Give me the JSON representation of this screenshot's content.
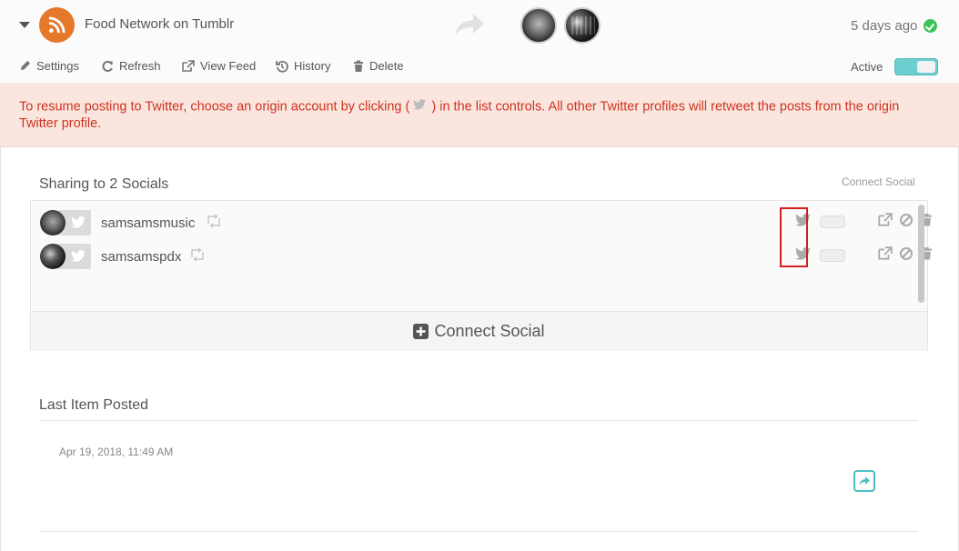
{
  "header": {
    "feed_title": "Food Network on Tumblr",
    "time_ago": "5 days ago",
    "active_label": "Active",
    "accent_color": "#6ccfcf"
  },
  "toolbar": {
    "settings": "Settings",
    "refresh": "Refresh",
    "view_feed": "View Feed",
    "history": "History",
    "delete": "Delete"
  },
  "warning": {
    "text_before": "To resume posting to Twitter, choose an origin account by clicking (",
    "text_after": ") in the list controls. All other Twitter profiles will retweet the posts from the origin Twitter profile.",
    "color": "#d0321e"
  },
  "sharing": {
    "title": "Sharing to 2 Socials",
    "connect_link": "Connect Social",
    "connect_button": "Connect Social",
    "accounts": [
      {
        "name": "samsamsmusic",
        "network_icon": "twitter-icon"
      },
      {
        "name": "samsamspdx",
        "network_icon": "twitter-icon"
      }
    ]
  },
  "last_item": {
    "title": "Last Item Posted",
    "date": "Apr 19, 2018, 11:49 AM"
  }
}
